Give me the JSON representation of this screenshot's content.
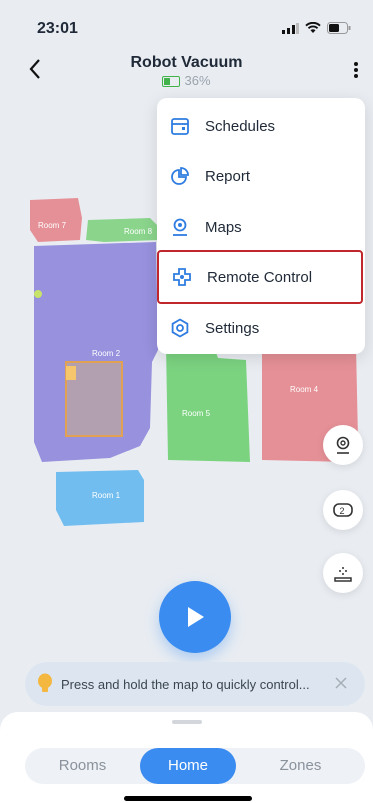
{
  "status": {
    "time": "23:01"
  },
  "header": {
    "title": "Robot Vacuum",
    "battery": "36%"
  },
  "menu": {
    "items": [
      {
        "label": "Schedules",
        "icon": "calendar-icon"
      },
      {
        "label": "Report",
        "icon": "pie-chart-icon"
      },
      {
        "label": "Maps",
        "icon": "map-pin-icon"
      },
      {
        "label": "Remote Control",
        "icon": "gamepad-icon",
        "highlighted": true
      },
      {
        "label": "Settings",
        "icon": "gear-icon"
      }
    ]
  },
  "map": {
    "rooms": [
      "Room 7",
      "Room 8",
      "Room 2",
      "Room 5",
      "Room 4",
      "Room 1"
    ],
    "colors": {
      "room7": "#e47f86",
      "room8": "#7fd081",
      "room2": "#8e86dc",
      "room5": "#6fcf73",
      "room4": "#e47f86",
      "room1": "#65b7f0",
      "zone": "#f0a43a"
    }
  },
  "side_buttons": [
    "location-pin-icon",
    "swap-icon",
    "dock-icon"
  ],
  "tip": {
    "text": "Press and hold the map to quickly control..."
  },
  "tabs": {
    "rooms": "Rooms",
    "home": "Home",
    "zones": "Zones",
    "selected": "Home"
  },
  "accent": "#3a8cf0"
}
